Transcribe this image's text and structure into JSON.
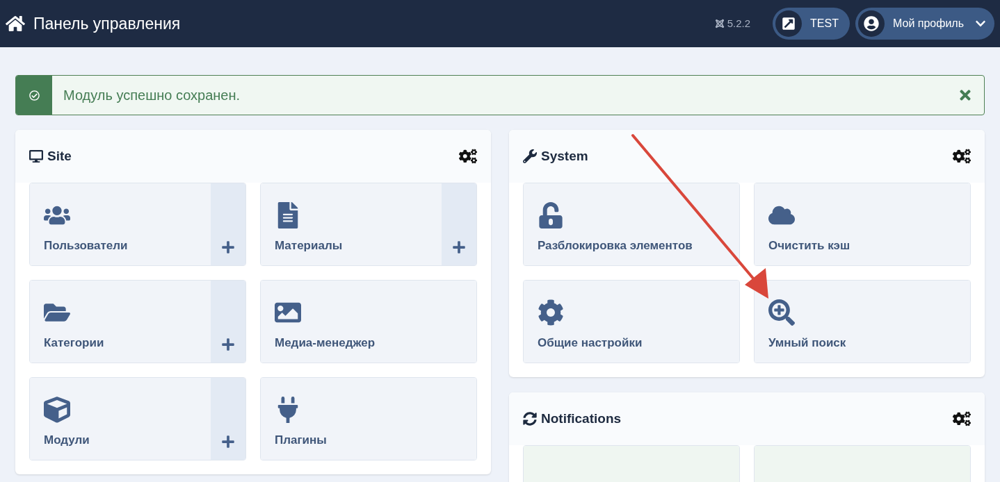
{
  "header": {
    "title": "Панель управления",
    "version": "5.2.2",
    "site_button": "TEST",
    "profile_button": "Мой профиль"
  },
  "alert": {
    "message": "Модуль успешно сохранен."
  },
  "columns": [
    {
      "panels": [
        {
          "title": "Site",
          "kind": "links",
          "tiles": [
            {
              "label": "Пользователи",
              "add": true
            },
            {
              "label": "Материалы",
              "add": true
            },
            {
              "label": "Категории",
              "add": true
            },
            {
              "label": "Медиа-менеджер",
              "add": false
            },
            {
              "label": "Модули",
              "add": true
            },
            {
              "label": "Плагины",
              "add": false
            }
          ]
        }
      ]
    },
    {
      "panels": [
        {
          "title": "System",
          "kind": "links",
          "tiles": [
            {
              "label": "Разблокировка элементов",
              "add": false
            },
            {
              "label": "Очистить кэш",
              "add": false
            },
            {
              "label": "Общие настройки",
              "add": false
            },
            {
              "label": "Умный поиск",
              "add": false
            }
          ]
        },
        {
          "title": "Notifications",
          "kind": "notifications"
        }
      ]
    }
  ]
}
